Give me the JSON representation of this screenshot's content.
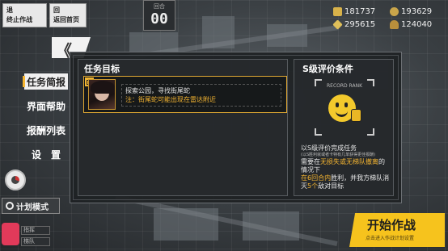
{
  "topbar": {
    "back": {
      "small": "退",
      "label": "终止作战"
    },
    "home": {
      "small": "回",
      "label": "返回首页"
    },
    "turn": {
      "label": "回合",
      "value": "00"
    }
  },
  "resources": {
    "manpower": "181737",
    "ammo": "193629",
    "rations": "295615",
    "parts": "124040"
  },
  "sidebar": {
    "collapse_label": "《",
    "items": [
      {
        "label": "任务简报"
      },
      {
        "label": "界面帮助"
      },
      {
        "label": "报酬列表"
      },
      {
        "label": "设　置"
      }
    ],
    "plan_mode": "计划模式",
    "unit_status": [
      "指挥",
      "梯队"
    ]
  },
  "objective": {
    "title": "任务目标",
    "line1": "探索公园，寻找街尾蛇",
    "line2": "注：街尾蛇可能出现在雷达附近"
  },
  "srank": {
    "title": "S级评价条件",
    "record_label": "RECORD RANK",
    "complete": "以S级评价完成任务",
    "note": "(以S胜利就或者卡特有几单获得更佳报酬)",
    "cond_a_pre": "需要在",
    "cond_a_hl": "无损失或无梯队撤离",
    "cond_a_post": "的情况下",
    "cond_b_hl1": "在6回合内",
    "cond_b_mid": "胜利，并我方梯队消灭",
    "cond_b_hl2": "5个",
    "cond_b_post": "敌对目标"
  },
  "start": {
    "label": "开始作战",
    "sub": "点击进入作战计划设置"
  },
  "colors": {
    "accent": "#f5b531",
    "start_button": "#f6c31d",
    "panel_bg": "#1e2124"
  }
}
